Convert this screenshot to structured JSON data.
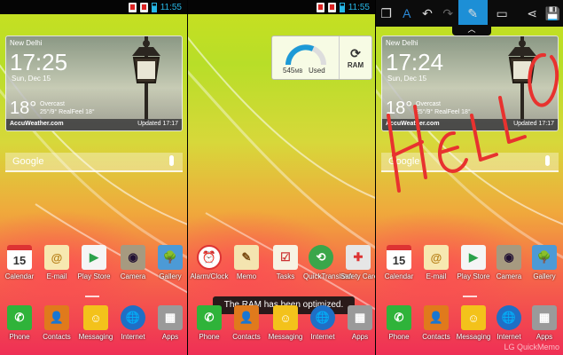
{
  "status": {
    "time": "11:55"
  },
  "left_panel": {
    "weather": {
      "city": "New Delhi",
      "time": "17:25",
      "date": "Sun, Dec 15",
      "temp": "18°",
      "condition": "Overcast",
      "detail": "25°/9° RealFeel 18°",
      "brand": "AccuWeather.com",
      "updated": "Updated 17:17"
    },
    "search_label": "Google",
    "apps": [
      {
        "label": "Calendar",
        "glyph": "15"
      },
      {
        "label": "E-mail",
        "glyph": "@"
      },
      {
        "label": "Play Store",
        "glyph": "▶"
      },
      {
        "label": "Camera",
        "glyph": "◉"
      },
      {
        "label": "Gallery",
        "glyph": "🌳"
      }
    ],
    "dock": [
      {
        "label": "Phone",
        "glyph": "✆"
      },
      {
        "label": "Contacts",
        "glyph": "👤"
      },
      {
        "label": "Messaging",
        "glyph": "☺"
      },
      {
        "label": "Internet",
        "glyph": "🌐"
      },
      {
        "label": "Apps",
        "glyph": "▦"
      }
    ]
  },
  "middle_panel": {
    "ram_widget": {
      "value": "545",
      "unit": "MB",
      "used_label": "Used",
      "button_label": "RAM"
    },
    "apps": [
      {
        "label": "Alarm/Clock",
        "glyph": "⏰"
      },
      {
        "label": "Memo",
        "glyph": "✎"
      },
      {
        "label": "Tasks",
        "glyph": "☑"
      },
      {
        "label": "QuickTranslator",
        "glyph": "⟲"
      },
      {
        "label": "Safety Care",
        "glyph": "✚"
      }
    ],
    "dock": [
      {
        "label": "Phone",
        "glyph": "✆"
      },
      {
        "label": "Contacts",
        "glyph": "👤"
      },
      {
        "label": "Messaging",
        "glyph": "☺"
      },
      {
        "label": "Internet",
        "glyph": "🌐"
      },
      {
        "label": "Apps",
        "glyph": "▦"
      }
    ],
    "toast": "The RAM has been optimized."
  },
  "right_panel": {
    "toolbar": [
      {
        "name": "copy-icon",
        "glyph": "❐"
      },
      {
        "name": "text-icon",
        "glyph": "A"
      },
      {
        "name": "undo-icon",
        "glyph": "↶"
      },
      {
        "name": "redo-icon",
        "glyph": "↷"
      },
      {
        "name": "pen-icon",
        "glyph": "✎"
      },
      {
        "name": "eraser-icon",
        "glyph": "▭"
      },
      {
        "name": "share-icon",
        "glyph": "⋖"
      },
      {
        "name": "save-icon",
        "glyph": "💾"
      }
    ],
    "weather": {
      "city": "New Delhi",
      "time": "17:24",
      "date": "Sun, Dec 15",
      "temp": "18°",
      "condition": "Overcast",
      "detail": "25°/9° RealFeel 18°",
      "brand": "AccuWeather.com",
      "updated": "Updated 17:17"
    },
    "scribble_text": "HELLO",
    "apps": [
      {
        "label": "Calendar",
        "glyph": "15"
      },
      {
        "label": "E-mail",
        "glyph": "@"
      },
      {
        "label": "Play Store",
        "glyph": "▶"
      },
      {
        "label": "Camera",
        "glyph": "◉"
      },
      {
        "label": "Gallery",
        "glyph": "🌳"
      }
    ],
    "dock": [
      {
        "label": "Phone",
        "glyph": "✆"
      },
      {
        "label": "Contacts",
        "glyph": "👤"
      },
      {
        "label": "Messaging",
        "glyph": "☺"
      },
      {
        "label": "Internet",
        "glyph": "🌐"
      },
      {
        "label": "Apps",
        "glyph": "▦"
      }
    ],
    "watermark": "LG QuickMemo"
  },
  "colors": {
    "accent": "#1d8fd6",
    "status_text": "#27b7e6",
    "scribble": "#e8322f"
  }
}
